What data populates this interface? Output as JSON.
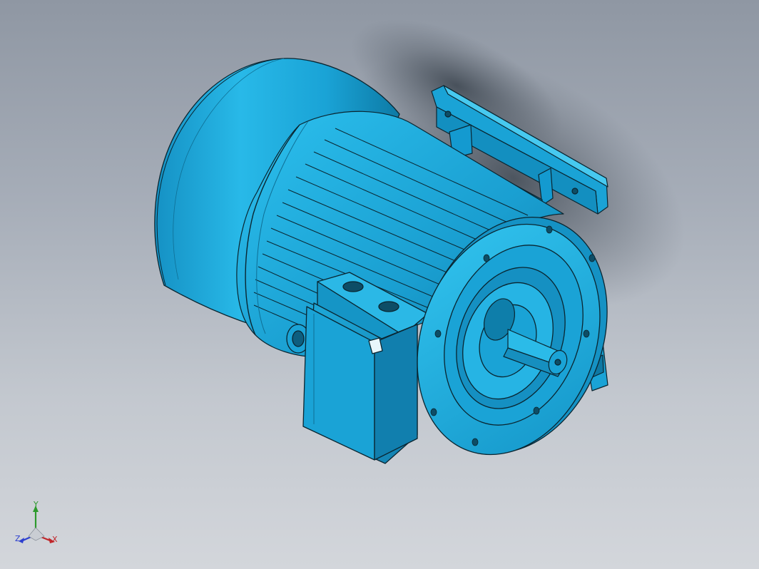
{
  "viewport": {
    "background_top": "#8f97a3",
    "background_bottom": "#d3d6db"
  },
  "model": {
    "part_color": "#1aa3d6",
    "part_shadow_color": "#0b6f95",
    "part_highlight_color": "#5fd2f2",
    "edge_color": "#0a2530"
  },
  "triad": {
    "x_label": "X",
    "y_label": "Y",
    "z_label": "Z",
    "x_color": "#c0262a",
    "y_color": "#2d9a2d",
    "z_color": "#2c3fcf"
  }
}
